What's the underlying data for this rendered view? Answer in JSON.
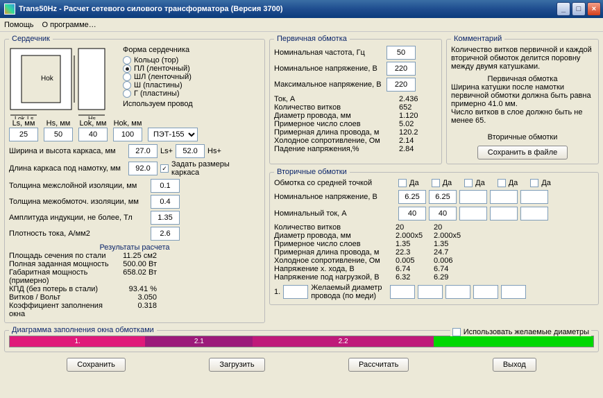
{
  "title": "Trans50Hz - Расчет сетевого силового трансформатора (Версия 3700)",
  "menu": {
    "help": "Помощь",
    "about": "О программе…"
  },
  "core": {
    "legend": "Сердечник",
    "shape_lbl": "Форма сердечника",
    "shapes": [
      "Кольцо (тор)",
      "ПЛ (ленточный)",
      "ШЛ (ленточный)",
      "Ш (пластины)",
      "Г (пластины)"
    ],
    "wire_lbl": "Используем провод",
    "wire_sel": "ПЭТ-155",
    "cols": [
      "Ls, мм",
      "Hs, мм",
      "Lok, мм",
      "Hok, мм"
    ],
    "vals": [
      "25",
      "50",
      "40",
      "100"
    ],
    "frame_wh": "Ширина и высота каркаса, мм",
    "frame_w": "27.0",
    "frame_ls": "Ls+",
    "frame_h": "52.0",
    "frame_hs": "Hs+",
    "frame_len": "Длина каркаса под намотку, мм",
    "frame_len_v": "92.0",
    "set_size": "Задать размеры каркаса",
    "layer_iso": "Толщина межслойной изоляции, мм",
    "layer_iso_v": "0.1",
    "coil_iso": "Толщина межобмоточ. изоляции, мм",
    "coil_iso_v": "0.4",
    "ind": "Амплитуда индукции, не более, Тл",
    "ind_v": "1.35",
    "dens": "Плотность тока, А/мм2",
    "dens_v": "2.6",
    "res_legend": "Результаты расчета",
    "res": [
      [
        "Площадь сечения по стали",
        "11.25 см2"
      ],
      [
        "Полная заданная мощность",
        "500.00 Вт"
      ],
      [
        "Габаритная мощность (примерно)",
        "658.02 Вт"
      ],
      [
        "КПД (без потерь в стали)",
        "93.41 %"
      ],
      [
        "Витков / Вольт",
        "3.050"
      ],
      [
        "Коэффициент заполнения окна",
        "0.318"
      ]
    ]
  },
  "primary": {
    "legend": "Первичная обмотка",
    "freq": "Номинальная частота, Гц",
    "freq_v": "50",
    "nomv": "Номинальное напряжение, В",
    "nomv_v": "220",
    "maxv": "Максимальное напряжение, В",
    "maxv_v": "220",
    "rows": [
      [
        "Ток, А",
        "2.436"
      ],
      [
        "Количество витков",
        "652"
      ],
      [
        "Диаметр провода, мм",
        "1.120"
      ],
      [
        "Примерное число слоев",
        "5.02"
      ],
      [
        "Примерная длина провода, м",
        "120.2"
      ],
      [
        "Холодное сопротивление, Ом",
        "2.14"
      ],
      [
        "Падение напряжения,%",
        "2.84"
      ]
    ]
  },
  "comments": {
    "legend": "Комментарий",
    "p1": "Количество витков первичной и каждой вторичной обмоток делится поровну между двумя катушками.",
    "h": "Первичная обмотка",
    "p2": "Ширина катушки после намотки первичной обмотки должна быть равна примерно 41.0 мм.",
    "p3": "Число витков в слое должно быть не менее 65.",
    "sec_h": "Вторичные обмотки",
    "save_btn": "Сохранить в файле"
  },
  "secondary": {
    "legend": "Вторичные обмотки",
    "midtap": "Обмотка со средней точкой",
    "da": "Да",
    "nomv": "Номинальное напряжение, В",
    "nomv_v": [
      "6.25",
      "6.25"
    ],
    "cur": "Номинальный ток, А",
    "cur_v": [
      "40",
      "40"
    ],
    "rows": [
      [
        "Количество витков",
        "20",
        "20"
      ],
      [
        "Диаметр провода, мм",
        "2.000x5",
        "2.000x5"
      ],
      [
        "Примерное число слоев",
        "1.35",
        "1.35"
      ],
      [
        "Примерная длина провода, м",
        "22.3",
        "24.7"
      ],
      [
        "Холодное сопротивление, Ом",
        "0.005",
        "0.006"
      ],
      [
        "Напряжение х. хода, В",
        "6.74",
        "6.74"
      ],
      [
        "Напряжение под нагрузкой, В",
        "6.32",
        "6.29"
      ]
    ],
    "desired": "Желаемый диаметр провода (по меди)",
    "use_desired": "Использовать желаемые диаметры"
  },
  "diagram": {
    "legend": "Диаграмма заполнения окна обмотками",
    "segs": [
      "1.",
      "2.1",
      "2.2",
      ""
    ],
    "colors": [
      "#e01a7a",
      "#9c1a7a",
      "#bf1a7a",
      "#00d800"
    ]
  },
  "buttons": {
    "save": "Сохранить",
    "load": "Загрузить",
    "calc": "Рассчитать",
    "exit": "Выход"
  }
}
